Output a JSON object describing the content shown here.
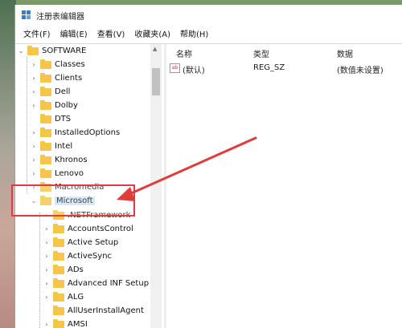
{
  "window": {
    "title": "注册表编辑器"
  },
  "menu": [
    "文件(F)",
    "编辑(E)",
    "查看(V)",
    "收藏夹(A)",
    "帮助(H)"
  ],
  "tree": {
    "root": "SOFTWARE",
    "children": [
      "Classes",
      "Clients",
      "Dell",
      "Dolby",
      "DTS",
      "InstalledOptions",
      "Intel",
      "Khronos",
      "Lenovo",
      "Macromedia"
    ],
    "selected": "Microsoft",
    "sub_children": [
      ".NETFramework",
      "AccountsControl",
      "Active Setup",
      "ActiveSync",
      "ADs",
      "Advanced INF Setup",
      "ALG",
      "AllUserInstallAgent",
      "AMSI"
    ]
  },
  "list": {
    "columns": [
      "名称",
      "类型",
      "数据"
    ],
    "rows": [
      {
        "name": "(默认)",
        "type": "REG_SZ",
        "data": "(数值未设置)"
      }
    ]
  },
  "colors": {
    "highlight": "#e23b3b",
    "folder": "#f6c54a",
    "selection": "#cce4f7"
  },
  "icons": {
    "app": "regedit-icon",
    "value": "string-value-icon"
  }
}
